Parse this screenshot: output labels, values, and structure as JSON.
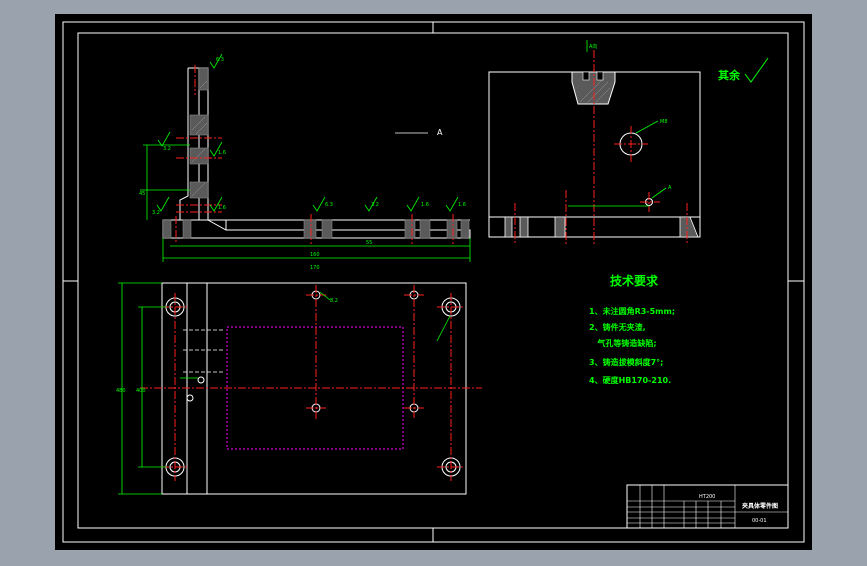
{
  "drawing": {
    "colors": {
      "background": "#9aa3ad",
      "sheet": "#000000",
      "outline": "#ffffff",
      "dimension": "#00ff00",
      "centerline": "#ff2020",
      "hidden": "#ff00ff",
      "hatch": "#7a7a7a",
      "title_text": "#00ff00"
    },
    "section_label": "A",
    "view_label": "A向",
    "other_roughness": "其余",
    "roughness_values": [
      "6.3",
      "3.2",
      "1.6",
      "1.6",
      "3.2",
      "6.3",
      "3.2",
      "1.6",
      "1.6",
      "3.2",
      "1.6"
    ],
    "top_view_hole_notes": [
      "M8"
    ],
    "front_view_hole_note": "A",
    "dimension_labels": [
      "45",
      "55",
      "160",
      "170",
      "480",
      "400"
    ],
    "plan_hole_note": "8.2",
    "tech_requirements": {
      "title": "技术要求",
      "items": [
        "1、未注圆角R3-5mm;",
        "2、铸件无夹渣,",
        "   气孔等铸造缺陷;",
        "3、铸造拔模斜度7°;",
        "4、硬度HB170-210."
      ]
    },
    "title_block": {
      "material": "HT200",
      "part_name": "夹具体零件图",
      "drawing_no": "00-01"
    }
  }
}
